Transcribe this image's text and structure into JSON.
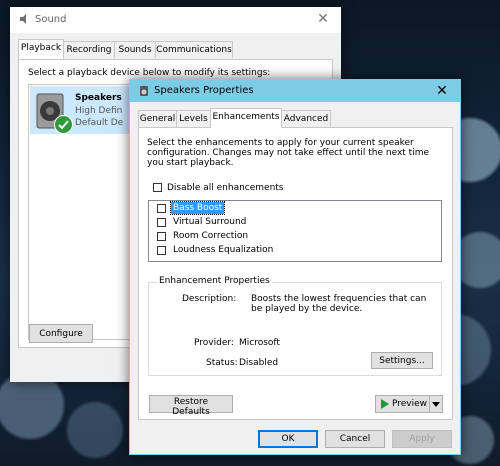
{
  "sound": {
    "title": "Sound",
    "close_glyph": "✕",
    "tabs": [
      "Playback",
      "Recording",
      "Sounds",
      "Communications"
    ],
    "instruction": "Select a playback device below to modify its settings:",
    "device": {
      "name": "Speakers",
      "line1": "High Defin",
      "line2": "Default De"
    },
    "configure_label": "Configure"
  },
  "props": {
    "title": "Speakers Properties",
    "close_glyph": "✕",
    "tabs": [
      "General",
      "Levels",
      "Enhancements",
      "Advanced"
    ],
    "description": "Select the enhancements to apply for your current speaker configuration. Changes may not take effect until the next time you start playback.",
    "disable_all_label": "Disable all enhancements",
    "enhancements": [
      "Bass Boost",
      "Virtual Surround",
      "Room Correction",
      "Loudness Equalization"
    ],
    "group_title": "Enhancement Properties",
    "description_label": "Description:",
    "description_value": "Boosts the lowest frequencies that can be played by the device.",
    "provider_label": "Provider:",
    "provider_value": "Microsoft",
    "status_label": "Status:",
    "status_value": "Disabled",
    "settings_label": "Settings...",
    "restore_label": "Restore Defaults",
    "preview_label": "Preview",
    "ok_label": "OK",
    "cancel_label": "Cancel",
    "apply_label": "Apply"
  },
  "colors": {
    "props_titlebar": "#7ecbe6",
    "selection": "#3399ff",
    "check_green": "#2e9a3a",
    "preview_green": "#1a9a3a"
  }
}
